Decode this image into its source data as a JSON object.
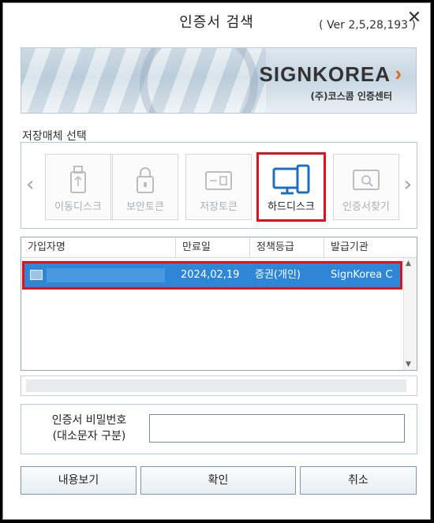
{
  "window": {
    "title": "인증서 검색",
    "version": "( Ver 2,5,28,193 )",
    "close_symbol": "✕"
  },
  "banner": {
    "logo": "SIGNKOREA",
    "logo_arrow": "›",
    "subtitle": "(주)코스콤 인증센터"
  },
  "storage": {
    "section_label": "저장매체 선택",
    "prev_arrow": "‹",
    "next_arrow": "›",
    "items": [
      {
        "label": "이동디스크",
        "icon": "usb-icon",
        "enabled": false
      },
      {
        "label": "보안토큰",
        "icon": "lock-icon",
        "enabled": false
      },
      {
        "label": "저장토큰",
        "icon": "token-icon",
        "enabled": false
      },
      {
        "label": "하드디스크",
        "icon": "monitor-icon",
        "enabled": true,
        "selected": true
      },
      {
        "label": "인증서찾기",
        "icon": "search-cert-icon",
        "enabled": false
      }
    ]
  },
  "table": {
    "columns": [
      "가입자명",
      "만료일",
      "정책등급",
      "발급기관"
    ],
    "rows": [
      {
        "name": "",
        "expiry": "2024,02,19",
        "policy": "증권(개인)",
        "issuer": "SignKorea C",
        "selected": true
      }
    ]
  },
  "password": {
    "label_line1": "인증서 비밀번호",
    "label_line2": "(대소문자 구분)",
    "value": ""
  },
  "buttons": {
    "view": "내용보기",
    "ok": "확인",
    "cancel": "취소"
  },
  "colors": {
    "highlight_border": "#e3101a",
    "selection": "#2e86d6",
    "accent_icon": "#1f6fc0",
    "brand_orange": "#e06a1a"
  }
}
